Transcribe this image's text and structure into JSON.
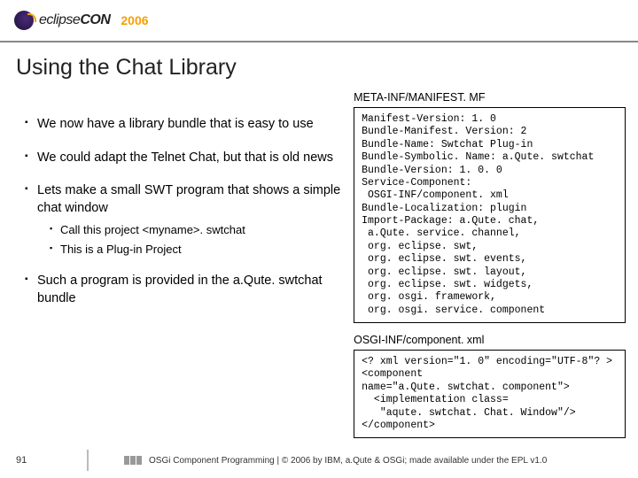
{
  "header": {
    "logo_text_prefix": "eclipse",
    "logo_text_bold": "CON",
    "year": "2006"
  },
  "title": "Using the Chat Library",
  "bullets": [
    {
      "text": "We now have a library bundle that is easy to use"
    },
    {
      "text": "We could adapt the Telnet Chat, but that is old news"
    },
    {
      "text": "Lets make a small SWT program that shows a simple chat window",
      "sub": [
        "Call this project <myname>. swtchat",
        "This is a Plug-in Project"
      ]
    },
    {
      "text": "Such a program is provided in the a.Qute. swtchat bundle"
    }
  ],
  "right": {
    "manifest_label": "META-INF/MANIFEST. MF",
    "manifest_body": "Manifest-Version: 1. 0\nBundle-Manifest. Version: 2\nBundle-Name: Swtchat Plug-in\nBundle-Symbolic. Name: a.Qute. swtchat\nBundle-Version: 1. 0. 0\nService-Component:\n OSGI-INF/component. xml\nBundle-Localization: plugin\nImport-Package: a.Qute. chat,\n a.Qute. service. channel,\n org. eclipse. swt,\n org. eclipse. swt. events,\n org. eclipse. swt. layout,\n org. eclipse. swt. widgets,\n org. osgi. framework,\n org. osgi. service. component",
    "component_label": "OSGI-INF/component. xml",
    "component_body": "<? xml version=\"1. 0\" encoding=\"UTF-8\"? >\n<component\nname=\"a.Qute. swtchat. component\">\n  <implementation class=\n   \"aqute. swtchat. Chat. Window\"/>\n</component>"
  },
  "footer": {
    "page": "91",
    "text": "OSGi Component Programming | © 2006 by IBM, a.Qute & OSGi; made available under the EPL v1.0"
  }
}
